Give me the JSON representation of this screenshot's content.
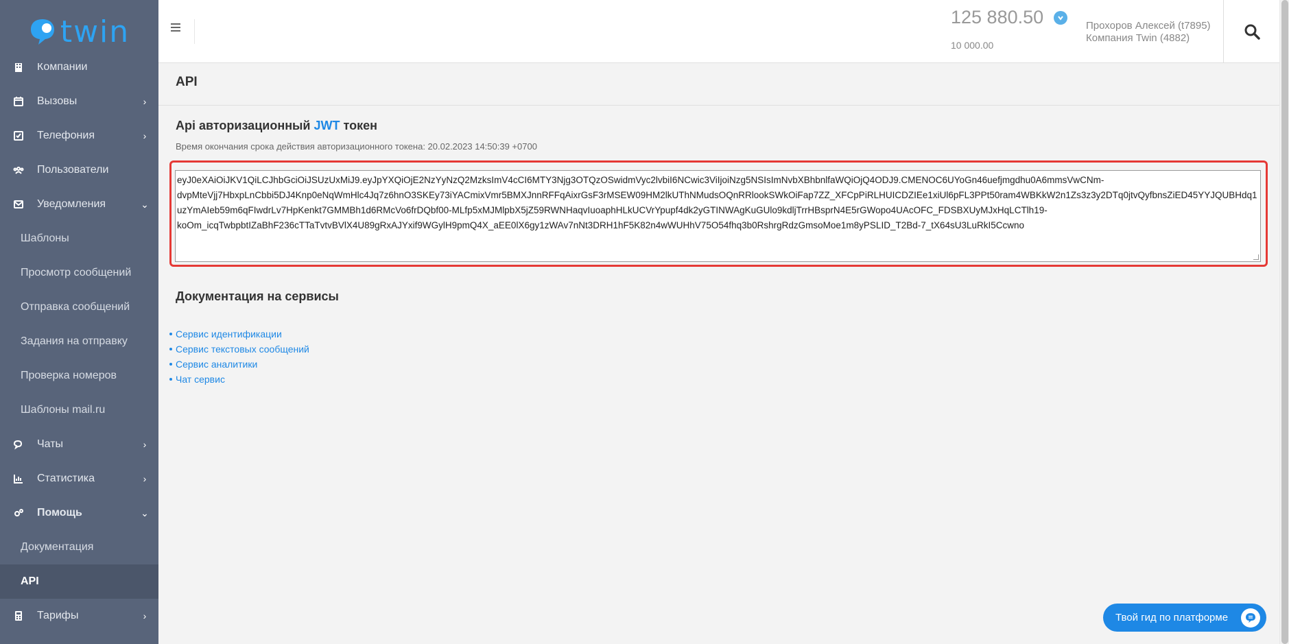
{
  "brand": {
    "logo_text": "twin"
  },
  "sidebar": {
    "items": [
      {
        "label": "Компании",
        "icon": "building-icon"
      },
      {
        "label": "Вызовы",
        "icon": "calendar-icon",
        "arrow": "›"
      },
      {
        "label": "Телефония",
        "icon": "phone-check-icon",
        "arrow": "›"
      },
      {
        "label": "Пользователи",
        "icon": "users-icon"
      },
      {
        "label": "Уведомления",
        "icon": "envelope-icon",
        "arrow": "⌄"
      },
      {
        "label": "Шаблоны"
      },
      {
        "label": "Просмотр сообщений"
      },
      {
        "label": "Отправка сообщений"
      },
      {
        "label": "Задания на отправку"
      },
      {
        "label": "Проверка номеров"
      },
      {
        "label": "Шаблоны mail.ru"
      },
      {
        "label": "Чаты",
        "icon": "chat-icon",
        "arrow": "›"
      },
      {
        "label": "Статистика",
        "icon": "bar-chart-icon",
        "arrow": "›"
      },
      {
        "label": "Помощь",
        "icon": "cogs-icon",
        "arrow": "⌄"
      },
      {
        "label": "Документация"
      },
      {
        "label": "API"
      },
      {
        "label": "Тарифы",
        "icon": "calculator-icon",
        "arrow": "›"
      }
    ]
  },
  "header": {
    "balance": "125 880.50",
    "credit": "10 000.00",
    "user": "Прохоров Алексей (t7895)",
    "company": "Компания Twin (4882)"
  },
  "page": {
    "title": "API",
    "token_section_prefix": "Api авторизационный ",
    "token_section_jwt": "JWT",
    "token_section_suffix": " токен",
    "expiry": "Время окончания срока действия авторизационного токена: 20.02.2023 14:50:39 +0700",
    "token": "eyJ0eXAiOiJKV1QiLCJhbGciOiJSUzUxMiJ9.eyJpYXQiOjE2NzYyNzQ2MzksImV4cCI6MTY3Njg3OTQzOSwidmVyc2lvbiI6NCwic3ViIjoiNzg5NSIsImNvbXBhbnlfaWQiOjQ4ODJ9.CMENOC6UYoGn46uefjmgdhu0A6mmsVwCNm-dvpMteVjj7HbxpLnCbbi5DJ4Knp0eNqWmHlc4Jq7z6hnO3SKEy73iYACmixVmr5BMXJnnRFFqAixrGsF3rMSEW09HM2lkUThNMudsOQnRRlookSWkOiFap7ZZ_XFCpPiRLHUICDZIEe1xiUl6pFL3PPt50ram4WBKkW2n1Zs3z3y2DTq0jtvQyfbnsZiED45YYJQUBHdq1uzYmAIeb59m6qFIwdrLv7HpKenkt7GMMBh1d6RMcVo6frDQbf00-MLfp5xMJMlpbX5jZ59RWNHaqvIuoaphHLkUCVrYpupf4dk2yGTINWAgKuGUlo9kdljTrrHBsprN4E5rGWopo4UAcOFC_FDSBXUyMJxHqLCTlh19-koOm_icqTwbpbtIZaBhF236cTTaTvtvBVlX4U89gRxAJYxif9WGylH9pmQ4X_aEE0lX6gy1zWAv7nNt3DRH1hF5K82n4wWUHhV75O54fhq3b0RshrgRdzGmsoMoe1m8yPSLID_T2Bd-7_tX64sU3LuRkI5Ccwno",
    "docs_title": "Документация на сервисы",
    "docs": [
      "Сервис идентификации",
      "Сервис текстовых сообщений",
      "Сервис аналитики",
      "Чат сервис"
    ]
  },
  "guide_button": {
    "label": "Твой гид по платформе"
  },
  "colors": {
    "sidebar": "#58647a",
    "accent": "#1e88e5",
    "highlight": "#e53935"
  }
}
